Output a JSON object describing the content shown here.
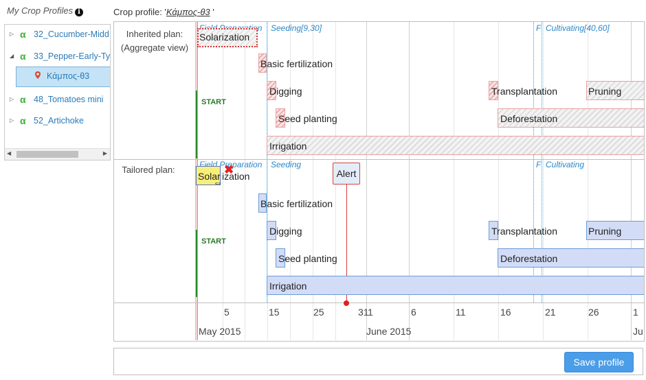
{
  "sidebar": {
    "title": "My Crop Profiles",
    "items": [
      {
        "label": "32_Cucumber-Midd"
      },
      {
        "label": "33_Pepper-Early-Ty"
      },
      {
        "label": "48_Tomatoes mini"
      },
      {
        "label": "52_Artichoke"
      }
    ],
    "selected_child": "Κάμπος-θ3"
  },
  "crop_profile": {
    "prefix": "Crop profile: '",
    "name": "Κάμπος-θ3",
    "suffix": "'"
  },
  "inherited": {
    "label_line1": "Inherited plan:",
    "label_line2": "(Aggregate view)",
    "phases": {
      "field_prep": "Field Preparation",
      "seeding": "Seeding[9,30]",
      "f": "F",
      "cultivating": "Cultivating[40,60]"
    },
    "start": "START",
    "tasks": {
      "solarization": "Solarization",
      "basic_fertilization": "Basic fertilization",
      "digging": "Digging",
      "transplantation": "Transplantation",
      "pruning": "Pruning",
      "seed_planting": "Seed planting",
      "deforestation": "Deforestation",
      "irrigation": "Irrigation"
    }
  },
  "tailored": {
    "label": "Tailored plan:",
    "phases": {
      "field_prep": "Field Preparation",
      "seeding": "Seeding",
      "f": "F",
      "cultivating": "Cultivating"
    },
    "start": "START",
    "alert": "Alert",
    "tasks": {
      "solarization_a": "Solar",
      "solarization_b": "ization",
      "basic_fertilization": "Basic fertilization",
      "digging": "Digging",
      "transplantation": "Transplantation",
      "pruning": "Pruning",
      "seed_planting": "Seed planting",
      "deforestation": "Deforestation",
      "irrigation": "Irrigation"
    }
  },
  "axis": {
    "ticks": [
      "5",
      "15",
      "25",
      "31",
      "1",
      "6",
      "11",
      "16",
      "21",
      "26",
      "1"
    ],
    "months": [
      "May 2015",
      "June 2015",
      "Ju"
    ]
  },
  "footer": {
    "save_label": "Save profile"
  }
}
